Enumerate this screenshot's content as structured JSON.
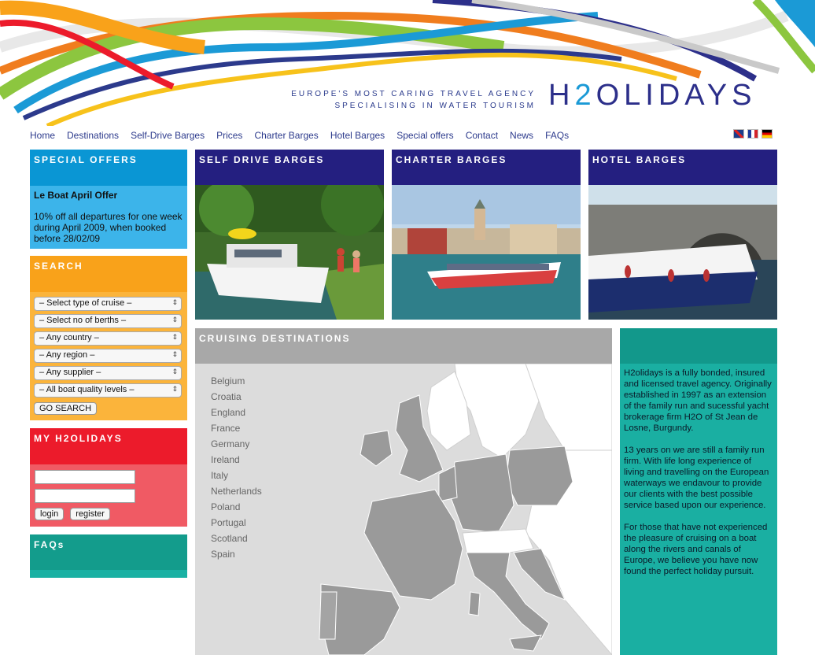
{
  "header": {
    "tagline_line1": "EUROPE'S MOST CARING TRAVEL AGENCY",
    "tagline_line2": "SPECIALISING IN WATER TOURISM",
    "logo_prefix": "H",
    "logo_digit": "2",
    "logo_suffix": "OLIDAYS"
  },
  "nav": {
    "items": [
      "Home",
      "Destinations",
      "Self-Drive Barges",
      "Prices",
      "Charter Barges",
      "Hotel Barges",
      "Special offers",
      "Contact",
      "News",
      "FAQs"
    ]
  },
  "flags": [
    "uk-flag-icon",
    "france-flag-icon",
    "germany-flag-icon"
  ],
  "special_offers": {
    "heading": "SPECIAL OFFERS",
    "title": "Le Boat April Offer",
    "text": "10% off all departures for one week during April 2009, when booked before 28/02/09"
  },
  "search": {
    "heading": "SEARCH",
    "selects": [
      "– Select type of cruise –",
      "– Select no of berths –",
      "– Any country –",
      "– Any region –",
      "– Any supplier –",
      "– All boat quality levels –"
    ],
    "button": "GO SEARCH"
  },
  "my_account": {
    "heading": "MY H2OLIDAYS",
    "login": "login",
    "register": "register"
  },
  "faqs": {
    "heading": "FAQs"
  },
  "barges": {
    "self_drive": "SELF DRIVE BARGES",
    "charter": "CHARTER BARGES",
    "hotel": "HOTEL BARGES"
  },
  "destinations": {
    "heading": "CRUISING DESTINATIONS",
    "countries": [
      "Belgium",
      "Croatia",
      "England",
      "France",
      "Germany",
      "Ireland",
      "Italy",
      "Netherlands",
      "Poland",
      "Portugal",
      "Scotland",
      "Spain"
    ]
  },
  "about": {
    "p1": "H2olidays is a fully bonded, insured and licensed travel agency. Originally established in 1997 as an extension of the family run and sucessful yacht brokerage firm H2O of St Jean de Losne, Burgundy.",
    "p2": "13 years on we are still a family run firm. With life long experience of living and travelling on the European waterways we endavour to provide our clients with the best possible service based upon our experience.",
    "p3": "For those that have not experienced the pleasure of cruising on a boat along the rivers and canals of Europe, we believe you have now found the perfect holiday pursuit."
  }
}
